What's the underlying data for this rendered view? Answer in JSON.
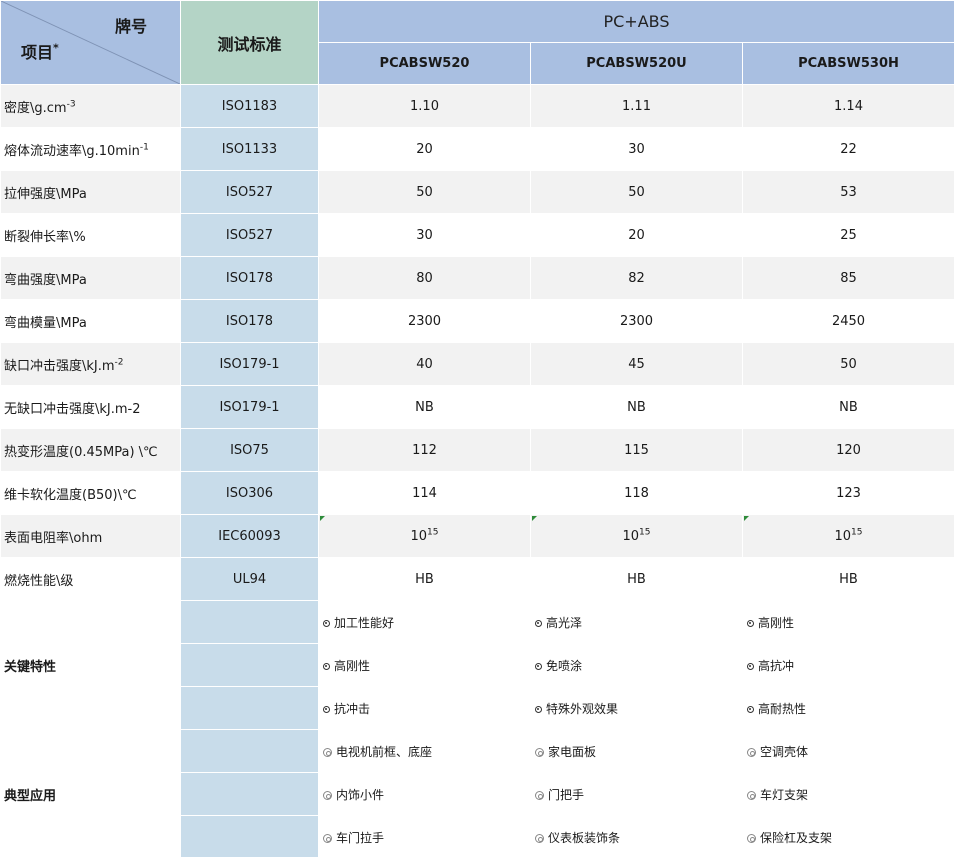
{
  "header": {
    "brand_label": "牌号",
    "item_label": "项目",
    "item_mark": "*",
    "standard_label": "测试标准",
    "group_label": "PC+ABS",
    "grades": [
      "PCABSW520",
      "PCABSW520U",
      "PCABSW530H"
    ]
  },
  "properties": [
    {
      "name": "密度\\g.cm",
      "name_sup": "-3",
      "standard": "ISO1183",
      "values": [
        "1.10",
        "1.11",
        "1.14"
      ]
    },
    {
      "name": "熔体流动速率\\g.10min",
      "name_sup": "-1",
      "standard": "ISO1133",
      "values": [
        "20",
        "30",
        "22"
      ]
    },
    {
      "name": "拉伸强度\\MPa",
      "name_sup": "",
      "standard": "ISO527",
      "values": [
        "50",
        "50",
        "53"
      ]
    },
    {
      "name": "断裂伸长率\\%",
      "name_sup": "",
      "standard": "ISO527",
      "values": [
        "30",
        "20",
        "25"
      ]
    },
    {
      "name": "弯曲强度\\MPa",
      "name_sup": "",
      "standard": "ISO178",
      "values": [
        "80",
        "82",
        "85"
      ]
    },
    {
      "name": "弯曲模量\\MPa",
      "name_sup": "",
      "standard": "ISO178",
      "values": [
        "2300",
        "2300",
        "2450"
      ]
    },
    {
      "name": "缺口冲击强度\\kJ.m",
      "name_sup": "-2",
      "standard": "ISO179-1",
      "values": [
        "40",
        "45",
        "50"
      ]
    },
    {
      "name": "无缺口冲击强度\\kJ.m-2",
      "name_sup": "",
      "standard": "ISO179-1",
      "values": [
        "NB",
        "NB",
        "NB"
      ]
    },
    {
      "name": "热变形温度(0.45MPa) \\℃",
      "name_sup": "",
      "standard": "ISO75",
      "values": [
        "112",
        "115",
        "120"
      ]
    },
    {
      "name": "维卡软化温度(B50)\\℃",
      "name_sup": "",
      "standard": "ISO306",
      "values": [
        "114",
        "118",
        "123"
      ]
    },
    {
      "name": "表面电阻率\\ohm",
      "name_sup": "",
      "standard": "IEC60093",
      "values": [
        "10",
        "10",
        "10"
      ],
      "value_sup": "15"
    },
    {
      "name": "燃烧性能\\级",
      "name_sup": "",
      "standard": "UL94",
      "values": [
        "HB",
        "HB",
        "HB"
      ]
    }
  ],
  "key_features": {
    "title": "关键特性",
    "rows": [
      [
        "加工性能好",
        "高光泽",
        "高刚性"
      ],
      [
        "高刚性",
        "免喷涂",
        "高抗冲"
      ],
      [
        "抗冲击",
        "特殊外观效果",
        "高耐热性"
      ]
    ]
  },
  "applications": {
    "title": "典型应用",
    "rows": [
      [
        "电视机前框、底座",
        "家电面板",
        "空调壳体"
      ],
      [
        "内饰小件",
        "门把手",
        "车灯支架"
      ],
      [
        "车门拉手",
        "仪表板装饰条",
        "保险杠及支架"
      ]
    ]
  },
  "colors": {
    "header_blue": "#a9bfe1",
    "header_green": "#b4d4c6",
    "standard_col": "#c8dcea",
    "row_gray": "#f2f2f2"
  }
}
